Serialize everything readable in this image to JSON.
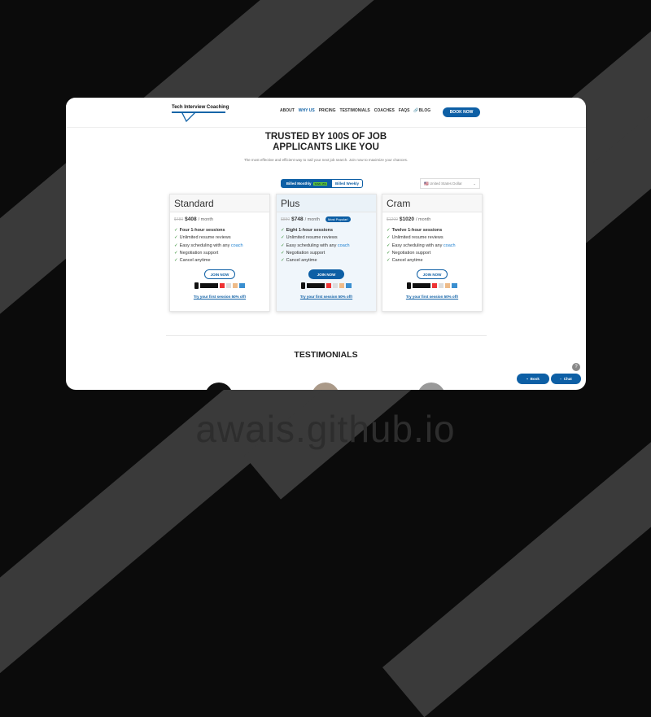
{
  "header": {
    "logo": "Tech Interview Coaching",
    "nav": [
      "ABOUT",
      "WHY US",
      "PRICING",
      "TESTIMONIALS",
      "COACHES",
      "FAQS",
      "BLOG"
    ],
    "active": "WHY US",
    "book_now": "BOOK NOW"
  },
  "hero": {
    "title_line1": "TRUSTED BY 100S OF JOB",
    "title_line2": "APPLICANTS LIKE YOU",
    "subtitle": "The most effective and efficient way to nail your next job search. Join now to maximize your chances."
  },
  "billing": {
    "monthly": "Billed Monthly",
    "save_badge": "SAVE 15%",
    "weekly": "Billed Weekly",
    "currency": "🇺🇸 United States Dollar"
  },
  "plans": [
    {
      "name": "Standard",
      "old_price": "$480",
      "price": "$408",
      "per": "/ month",
      "sessions": "Four 1-hour sessions",
      "popular": ""
    },
    {
      "name": "Plus",
      "old_price": "$880",
      "price": "$748",
      "per": "/ month",
      "sessions": "Eight 1-hour sessions",
      "popular": "Most Popular!"
    },
    {
      "name": "Cram",
      "old_price": "$1200",
      "price": "$1020",
      "per": "/ month",
      "sessions": "Twelve 1-hour sessions",
      "popular": ""
    }
  ],
  "features": {
    "resume": "Unlimited resume reviews",
    "sched": "Easy scheduling with any",
    "coach": "coach",
    "neg": "Negotiation support",
    "cancel": "Cancel anytime",
    "check": "✓"
  },
  "join": "JOIN NOW",
  "try": "Try your first session 50% off!",
  "testimonials": {
    "title": "TESTIMONIALS"
  },
  "floating": {
    "book": "Book",
    "chat": "Chat",
    "help": "?"
  },
  "watermark": "awais.github.io",
  "colors": {
    "brand": "#0d5fa5",
    "check": "#2a8a2a"
  }
}
